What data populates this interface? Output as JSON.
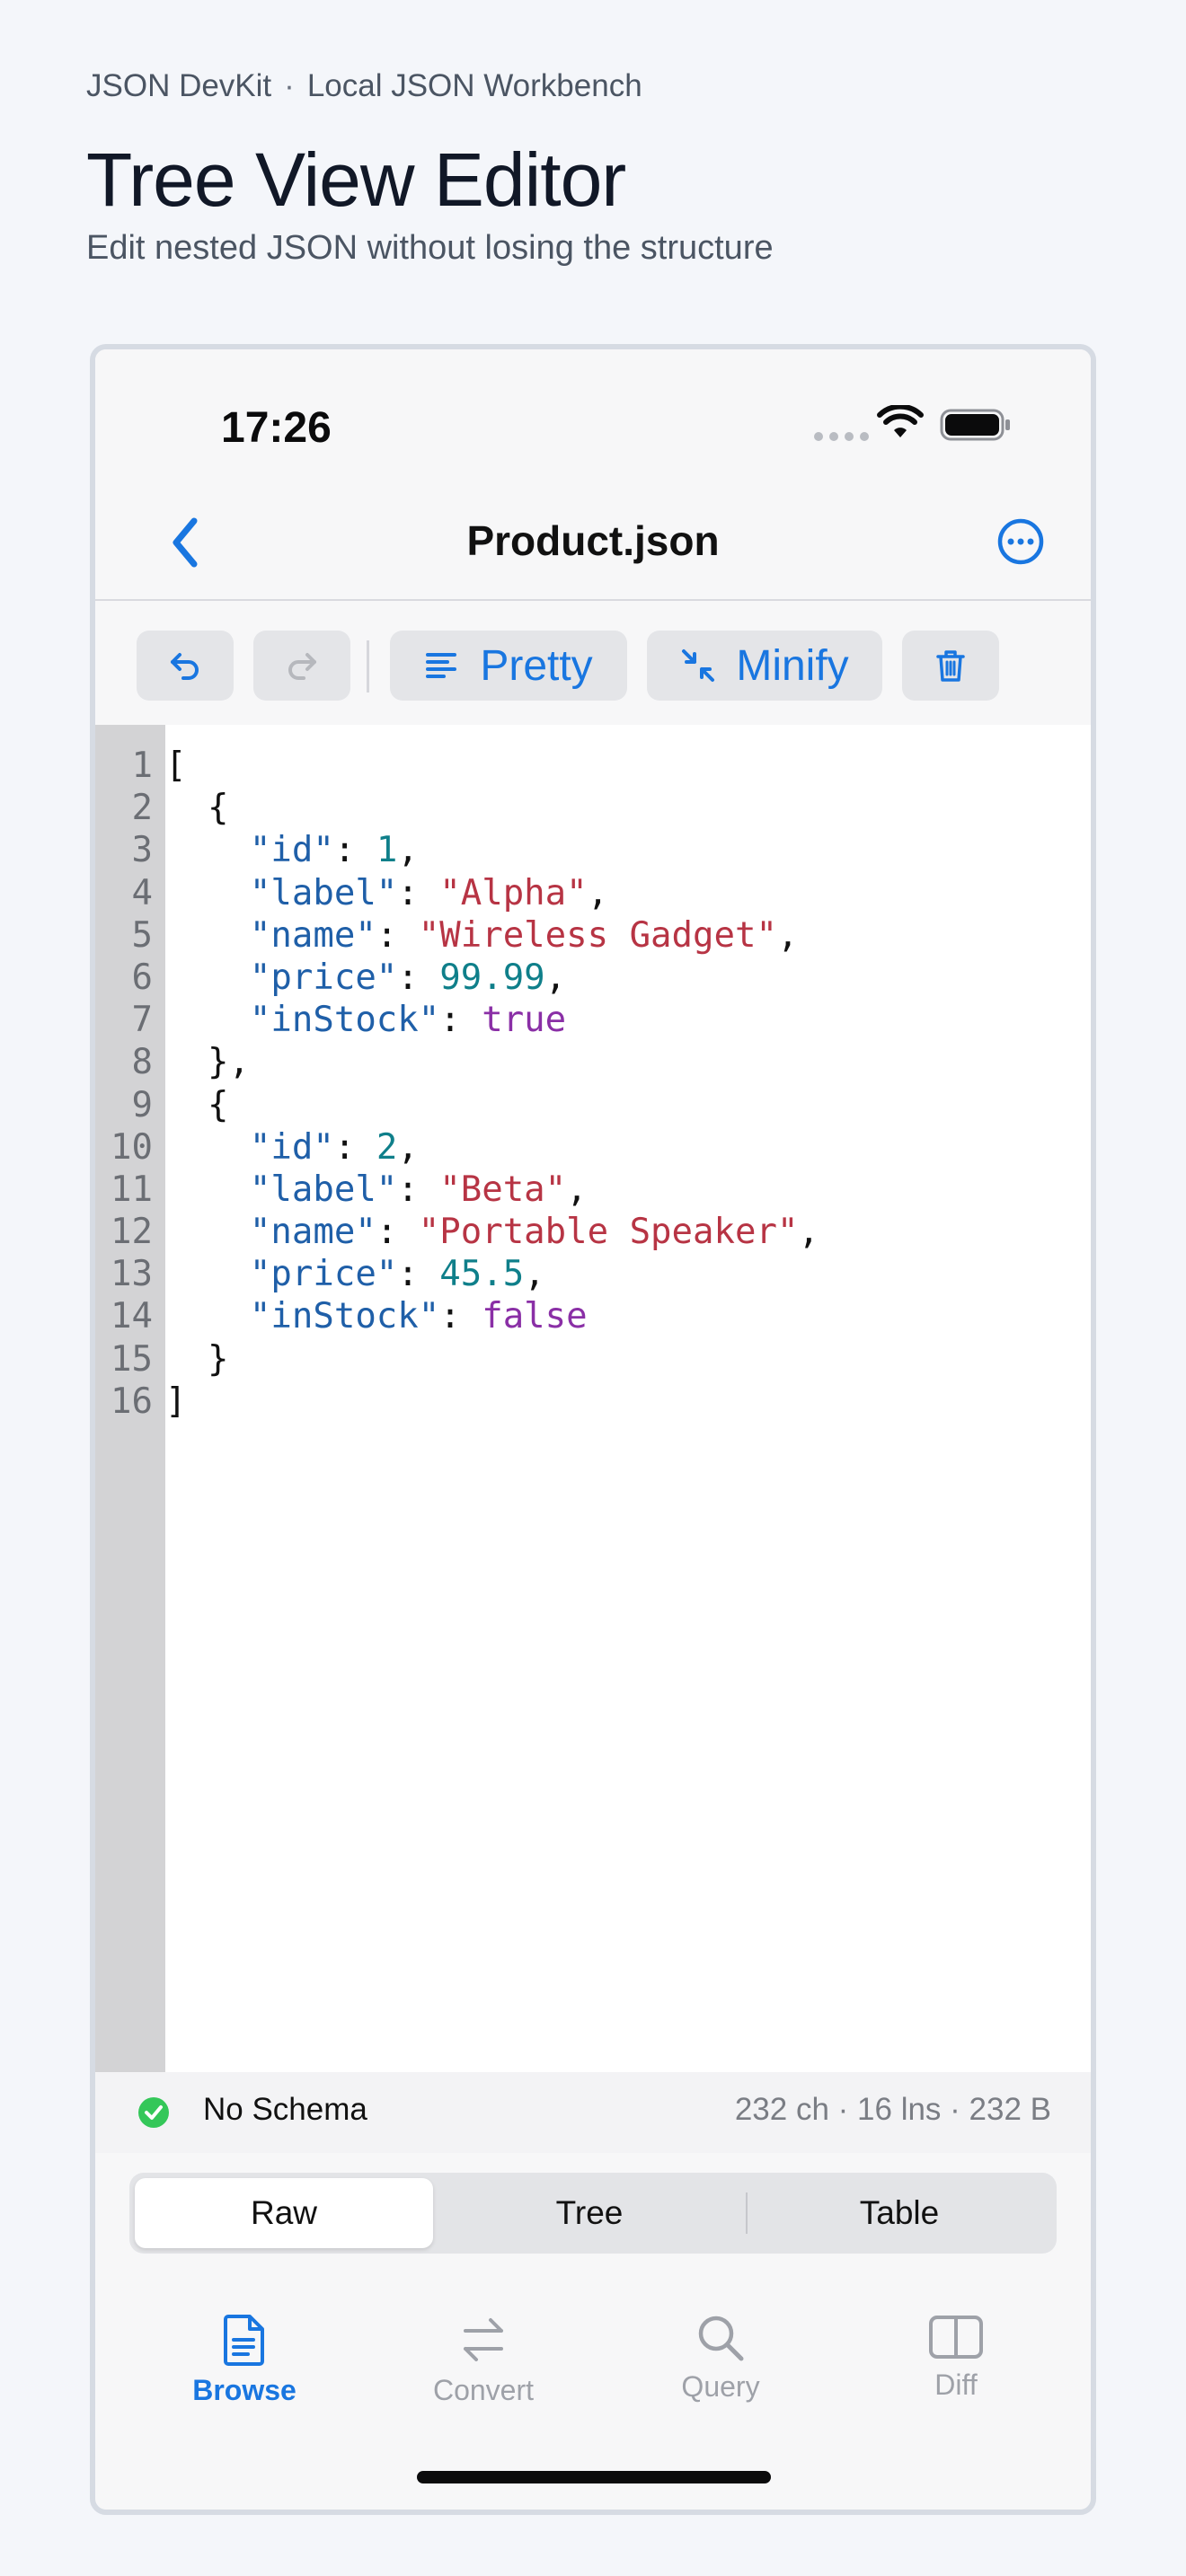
{
  "page": {
    "app_name": "JSON DevKit",
    "separator": "·",
    "tagline": "Local JSON Workbench",
    "title": "Tree View Editor",
    "subtitle": "Edit nested JSON without losing the structure"
  },
  "status_bar": {
    "time": "17:26"
  },
  "nav": {
    "title": "Product.json",
    "back_icon": "chevron-left-icon",
    "more_icon": "ellipsis-circle-icon"
  },
  "toolbar": {
    "undo_icon": "undo-icon",
    "redo_icon": "redo-icon",
    "pretty_label": "Pretty",
    "minify_label": "Minify",
    "delete_icon": "trash-icon"
  },
  "editor": {
    "line_numbers": [
      "1",
      "2",
      "3",
      "4",
      "5",
      "6",
      "7",
      "8",
      "9",
      "10",
      "11",
      "12",
      "13",
      "14",
      "15",
      "16"
    ],
    "lines": [
      [
        [
          "p",
          "["
        ]
      ],
      [
        [
          "p",
          "  {"
        ]
      ],
      [
        [
          "p",
          "    "
        ],
        [
          "k",
          "\"id\""
        ],
        [
          "p",
          ": "
        ],
        [
          "n",
          "1"
        ],
        [
          "p",
          ","
        ]
      ],
      [
        [
          "p",
          "    "
        ],
        [
          "k",
          "\"label\""
        ],
        [
          "p",
          ": "
        ],
        [
          "s",
          "\"Alpha\""
        ],
        [
          "p",
          ","
        ]
      ],
      [
        [
          "p",
          "    "
        ],
        [
          "k",
          "\"name\""
        ],
        [
          "p",
          ": "
        ],
        [
          "s",
          "\"Wireless Gadget\""
        ],
        [
          "p",
          ","
        ]
      ],
      [
        [
          "p",
          "    "
        ],
        [
          "k",
          "\"price\""
        ],
        [
          "p",
          ": "
        ],
        [
          "n",
          "99.99"
        ],
        [
          "p",
          ","
        ]
      ],
      [
        [
          "p",
          "    "
        ],
        [
          "k",
          "\"inStock\""
        ],
        [
          "p",
          ": "
        ],
        [
          "b",
          "true"
        ]
      ],
      [
        [
          "p",
          "  },"
        ]
      ],
      [
        [
          "p",
          "  {"
        ]
      ],
      [
        [
          "p",
          "    "
        ],
        [
          "k",
          "\"id\""
        ],
        [
          "p",
          ": "
        ],
        [
          "n",
          "2"
        ],
        [
          "p",
          ","
        ]
      ],
      [
        [
          "p",
          "    "
        ],
        [
          "k",
          "\"label\""
        ],
        [
          "p",
          ": "
        ],
        [
          "s",
          "\"Beta\""
        ],
        [
          "p",
          ","
        ]
      ],
      [
        [
          "p",
          "    "
        ],
        [
          "k",
          "\"name\""
        ],
        [
          "p",
          ": "
        ],
        [
          "s",
          "\"Portable Speaker\""
        ],
        [
          "p",
          ","
        ]
      ],
      [
        [
          "p",
          "    "
        ],
        [
          "k",
          "\"price\""
        ],
        [
          "p",
          ": "
        ],
        [
          "n",
          "45.5"
        ],
        [
          "p",
          ","
        ]
      ],
      [
        [
          "p",
          "    "
        ],
        [
          "k",
          "\"inStock\""
        ],
        [
          "p",
          ": "
        ],
        [
          "b",
          "false"
        ]
      ],
      [
        [
          "p",
          "  }"
        ]
      ],
      [
        [
          "p",
          "]"
        ]
      ]
    ]
  },
  "info": {
    "schema": "No Schema",
    "stats": "232 ch · 16 lns · 232 B"
  },
  "segments": {
    "raw": "Raw",
    "tree": "Tree",
    "table": "Table",
    "selected": "Raw"
  },
  "tabs": {
    "browse": "Browse",
    "convert": "Convert",
    "query": "Query",
    "diff": "Diff",
    "selected": "Browse"
  },
  "colors": {
    "accent": "#1976e0",
    "key": "#1f5fa8",
    "string": "#b73444",
    "number": "#0f7f8a",
    "boolean": "#8a2fa6",
    "success": "#34c759"
  }
}
